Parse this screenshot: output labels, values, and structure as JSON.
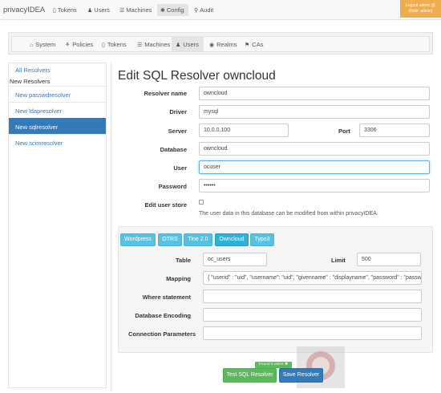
{
  "navbar": {
    "brand": "privacyIDEA",
    "items": [
      {
        "label": "Tokens",
        "icon": "mobile-icon"
      },
      {
        "label": "Users",
        "icon": "user-icon"
      },
      {
        "label": "Machines",
        "icon": "list-icon"
      },
      {
        "label": "Config",
        "icon": "gear-icon"
      },
      {
        "label": "Audit",
        "icon": "search-icon"
      }
    ],
    "logout_line1": "Logout admin @",
    "logout_line2": "(Role: admin)"
  },
  "subnav": {
    "items": [
      {
        "label": "System",
        "icon": "bank-icon"
      },
      {
        "label": "Policies",
        "icon": "tree-icon"
      },
      {
        "label": "Tokens",
        "icon": "mobile-icon"
      },
      {
        "label": "Machines",
        "icon": "list-icon"
      },
      {
        "label": "Users",
        "icon": "user-icon"
      },
      {
        "label": "Realms",
        "icon": "globe-icon"
      },
      {
        "label": "CAs",
        "icon": "flag-icon"
      }
    ]
  },
  "sidebar": {
    "all_resolvers": "All Resolvers",
    "new_resolvers_heading": "New Resolvers",
    "items": [
      {
        "label": "New passwdresolver"
      },
      {
        "label": "New ldapresolver"
      },
      {
        "label": "New sqlresolver"
      },
      {
        "label": "New scimresolver"
      }
    ]
  },
  "form": {
    "title": "Edit SQL Resolver owncloud",
    "resolver_name_label": "Resolver name",
    "resolver_name_value": "owncloud",
    "driver_label": "Driver",
    "driver_value": "mysql",
    "server_label": "Server",
    "server_value": "10.0.0.100",
    "port_label": "Port",
    "port_value": "3306",
    "database_label": "Database",
    "database_value": "owncloud",
    "user_label": "User",
    "user_value": "ocuser",
    "password_label": "Password",
    "password_value": "••••••",
    "edit_user_store_label": "Edit user store",
    "edit_user_store_help": "The user data in this database can be modified from within privacyIDEA."
  },
  "presets": {
    "items": [
      {
        "label": "Wordpress"
      },
      {
        "label": "OTRS"
      },
      {
        "label": "Tine 2.0"
      },
      {
        "label": "Owncloud"
      },
      {
        "label": "Typo3"
      }
    ],
    "table_label": "Table",
    "table_value": "oc_users",
    "limit_label": "Limit",
    "limit_value": "500",
    "mapping_label": "Mapping",
    "mapping_value": "{ \"userid\" : \"uid\", \"username\": \"uid\", \"givenname\" : \"displayname\", \"password\" : \"password\" }",
    "where_label": "Where statement",
    "where_value": "",
    "encoding_label": "Database Encoding",
    "encoding_value": "",
    "conn_params_label": "Connection Parameters",
    "conn_params_value": ""
  },
  "actions": {
    "found_badge": "Found 2 users ✖",
    "test_label": "Test SQL Resolver",
    "save_label": "Save Resolver"
  },
  "colors": {
    "primary": "#337ab7",
    "info": "#5bc0de",
    "success": "#5cb85c",
    "warning": "#f0ad4e"
  }
}
